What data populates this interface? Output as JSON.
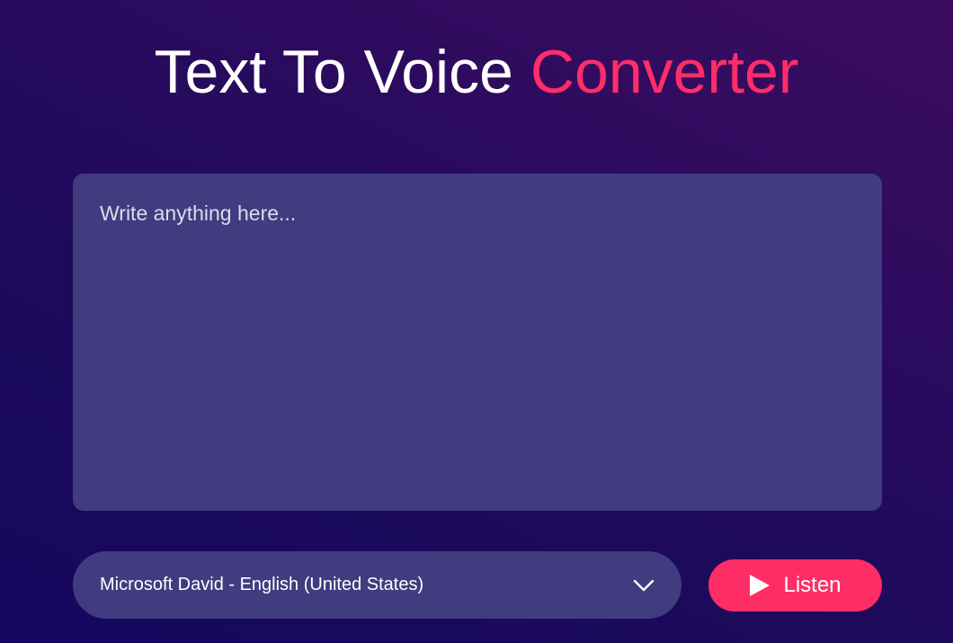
{
  "header": {
    "title_main": "Text To Voice",
    "title_accent": "Converter"
  },
  "editor": {
    "placeholder": "Write anything here...",
    "value": ""
  },
  "voice_select": {
    "selected": "Microsoft David - English (United States)",
    "icon": "chevron-down-icon"
  },
  "listen_button": {
    "label": "Listen",
    "icon": "play-icon"
  },
  "colors": {
    "accent": "#ff2d6a",
    "panel": "#403c7f",
    "background_dark": "#150860",
    "background_light": "#3d0c60"
  }
}
